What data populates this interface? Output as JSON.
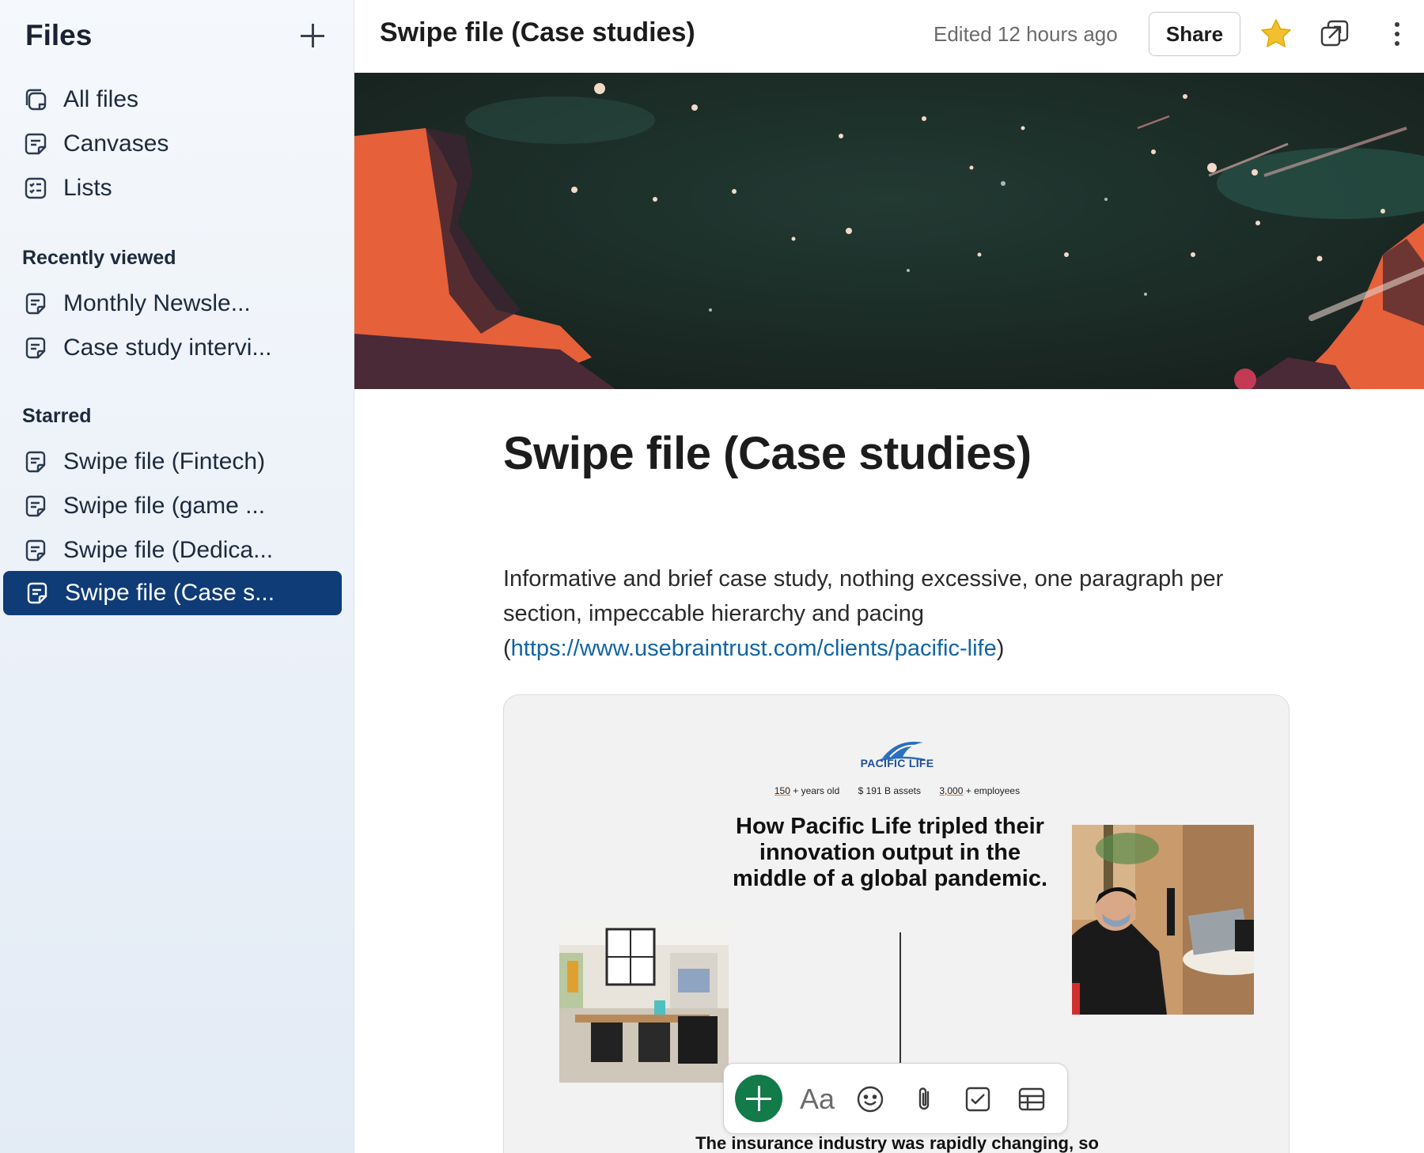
{
  "sidebar": {
    "title": "Files",
    "nav": [
      {
        "label": "All files",
        "icon": "all-files-icon"
      },
      {
        "label": "Canvases",
        "icon": "canvas-icon"
      },
      {
        "label": "Lists",
        "icon": "list-icon"
      }
    ],
    "recent_heading": "Recently viewed",
    "recent": [
      {
        "label": "Monthly Newsle..."
      },
      {
        "label": "Case study intervi..."
      }
    ],
    "starred_heading": "Starred",
    "starred": [
      {
        "label": "Swipe file (Fintech)"
      },
      {
        "label": "Swipe file (game ..."
      },
      {
        "label": "Swipe file (Dedica..."
      },
      {
        "label": "Swipe file (Case s..."
      }
    ]
  },
  "header": {
    "title": "Swipe file (Case studies)",
    "edited": "Edited 12 hours ago",
    "share_label": "Share",
    "star_color": "#f2c02e"
  },
  "document": {
    "heading": "Swipe file (Case studies)",
    "paragraph_text": "Informative and brief case study, nothing excessive, one paragraph per section, impeccable hierarchy and pacing (",
    "link_text": "https://www.usebraintrust.com/clients/pacific-life",
    "paragraph_end": ")"
  },
  "embed": {
    "logo_text": "PACIFIC LIFE",
    "stats": [
      {
        "num": "150",
        "text": " + years old"
      },
      {
        "num": "$ 191",
        "text": " B assets"
      },
      {
        "num": "3,000",
        "text": " + employees"
      }
    ],
    "headline": "How Pacific Life tripled their innovation output in the middle of a global pandemic.",
    "footer_text": "The insurance industry was rapidly changing, so"
  },
  "toolbar": {
    "text_style_label": "Aa",
    "accent_color": "#137a4a"
  },
  "colors": {
    "active_item": "#0f3b77",
    "link": "#1264a3"
  }
}
